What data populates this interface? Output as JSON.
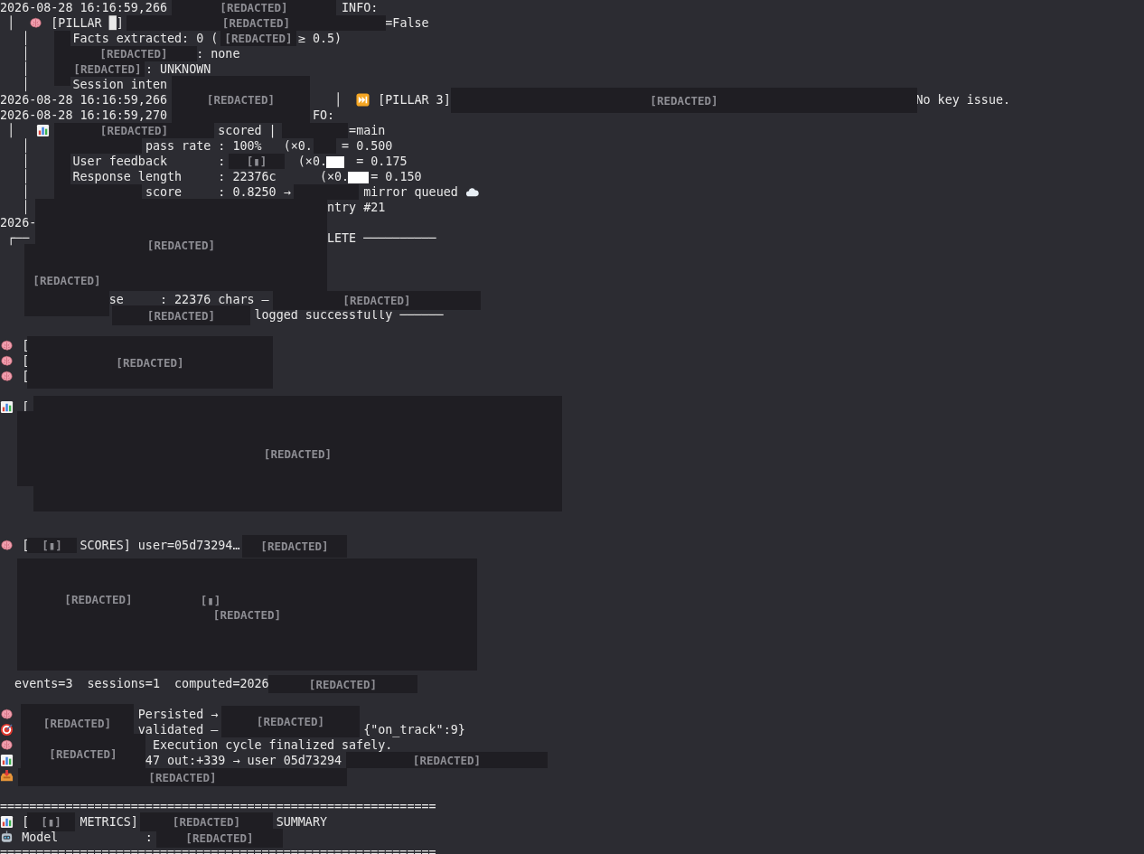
{
  "lines": [
    {
      "parts": [
        {
          "kind": "text",
          "text": "2026-08-28 16:16:59,266"
        },
        {
          "kind": "text",
          "text": "                        INFO:"
        }
      ]
    },
    {
      "parts": [
        {
          "kind": "text",
          "text": " │  "
        },
        {
          "kind": "brain"
        },
        {
          "kind": "text",
          "text": " [PILLAR █]"
        },
        {
          "kind": "text",
          "text": "                                    =False"
        }
      ]
    },
    {
      "parts": [
        {
          "kind": "text",
          "text": "   │"
        },
        {
          "kind": "text",
          "text": "      Facts extracted: 0 ("
        },
        {
          "kind": "text",
          "text": "           ≥ 0.5)"
        }
      ]
    },
    {
      "parts": [
        {
          "kind": "text",
          "text": "   │"
        },
        {
          "kind": "text",
          "text": "                       : none"
        }
      ]
    },
    {
      "parts": [
        {
          "kind": "text",
          "text": "   │"
        },
        {
          "kind": "text",
          "text": "                : UNKNOWN"
        }
      ]
    },
    {
      "parts": [
        {
          "kind": "text",
          "text": "   │"
        },
        {
          "kind": "text",
          "text": "      Session inten"
        }
      ]
    },
    {
      "parts": [
        {
          "kind": "text",
          "text": "2026-08-28 16:16:59,266"
        },
        {
          "kind": "text",
          "text": "                       │  "
        },
        {
          "kind": "skip"
        },
        {
          "kind": "text",
          "text": " [PILLAR 3]"
        },
        {
          "kind": "text",
          "text": "                                                                No key issue."
        }
      ]
    },
    {
      "parts": [
        {
          "kind": "text",
          "text": "2026-08-28 16:16:59,270"
        },
        {
          "kind": "text",
          "text": "                    FO:"
        }
      ]
    },
    {
      "parts": [
        {
          "kind": "text",
          "text": " │   "
        },
        {
          "kind": "chart"
        },
        {
          "kind": "text",
          "text": "                       scored |"
        },
        {
          "kind": "text",
          "text": "          =main"
        }
      ]
    },
    {
      "parts": [
        {
          "kind": "text",
          "text": "   │"
        },
        {
          "kind": "text",
          "text": "                pass rate : 100%   (×0."
        },
        {
          "kind": "text",
          "text": "    = 0.500"
        }
      ]
    },
    {
      "parts": [
        {
          "kind": "text",
          "text": "   │"
        },
        {
          "kind": "text",
          "text": "      User feedback       :"
        },
        {
          "kind": "text",
          "text": "          (×0."
        },
        {
          "kind": "text",
          "text": "    = 0.175"
        }
      ]
    },
    {
      "parts": [
        {
          "kind": "text",
          "text": "   │"
        },
        {
          "kind": "text",
          "text": "      Response length     : 22376c"
        },
        {
          "kind": "text",
          "text": "      (×0."
        },
        {
          "kind": "text",
          "text": "   = 0.150"
        }
      ]
    },
    {
      "parts": [
        {
          "kind": "text",
          "text": "   │"
        },
        {
          "kind": "text",
          "text": "                score     : 0.8250 →"
        },
        {
          "kind": "text",
          "text": "          mirror queued "
        },
        {
          "kind": "cloud"
        }
      ]
    },
    {
      "parts": [
        {
          "kind": "text",
          "text": "   │"
        },
        {
          "kind": "text",
          "text": "                                         ntry #21"
        }
      ]
    },
    {
      "parts": [
        {
          "kind": "text",
          "text": "2026-"
        }
      ]
    },
    {
      "parts": [
        {
          "kind": "text",
          "text": " ┌──"
        },
        {
          "kind": "text",
          "text": "                                         LETE ──────────"
        }
      ]
    },
    {
      "blank": true
    },
    {
      "blank": true
    },
    {
      "blank": true
    },
    {
      "parts": [
        {
          "kind": "text",
          "text": "               se     : 22376 chars —"
        }
      ]
    },
    {
      "parts": [
        {
          "kind": "text",
          "text": "                                   logged successfully ──────"
        }
      ]
    },
    {
      "blank": true
    },
    {
      "parts": [
        {
          "kind": "brain"
        },
        {
          "kind": "text",
          "text": " ["
        }
      ]
    },
    {
      "parts": [
        {
          "kind": "brain"
        },
        {
          "kind": "text",
          "text": " ["
        }
      ]
    },
    {
      "parts": [
        {
          "kind": "brain"
        },
        {
          "kind": "text",
          "text": " ["
        }
      ]
    },
    {
      "blank": true
    },
    {
      "parts": [
        {
          "kind": "chart"
        },
        {
          "kind": "text",
          "text": " ["
        }
      ]
    },
    {
      "blank": true
    },
    {
      "blank": true
    },
    {
      "blank": true
    },
    {
      "blank": true
    },
    {
      "blank": true
    },
    {
      "blank": true
    },
    {
      "blank": true
    },
    {
      "blank": true
    },
    {
      "parts": [
        {
          "kind": "brain"
        },
        {
          "kind": "text",
          "text": " ["
        },
        {
          "kind": "text",
          "text": "       SCORES] user=05d73294…"
        }
      ]
    },
    {
      "blank": true
    },
    {
      "blank": true
    },
    {
      "blank": true
    },
    {
      "blank": true
    },
    {
      "parts": [
        {
          "kind": "cursor"
        }
      ]
    },
    {
      "blank": true
    },
    {
      "blank": true
    },
    {
      "blank": true
    },
    {
      "parts": [
        {
          "kind": "text",
          "text": "  events=3  sessions=1  computed=2026"
        }
      ]
    },
    {
      "blank": true
    },
    {
      "parts": [
        {
          "kind": "brain"
        },
        {
          "kind": "text",
          "text": "                 Persisted →"
        }
      ]
    },
    {
      "parts": [
        {
          "kind": "target"
        },
        {
          "kind": "text",
          "text": "                 validated —"
        },
        {
          "kind": "text",
          "text": "                    {\"on_track\":9}"
        }
      ]
    },
    {
      "parts": [
        {
          "kind": "brain"
        },
        {
          "kind": "text",
          "text": "                   Execution cycle finalized safely."
        }
      ]
    },
    {
      "parts": [
        {
          "kind": "chart"
        },
        {
          "kind": "text",
          "text": "                  47 out:+339 → user 05d73294"
        }
      ]
    },
    {
      "parts": [
        {
          "kind": "inbox"
        }
      ]
    },
    {
      "blank": true
    },
    {
      "parts": [
        {
          "kind": "text",
          "text": "============================================================"
        }
      ]
    },
    {
      "parts": [
        {
          "kind": "chart"
        },
        {
          "kind": "text",
          "text": " ["
        },
        {
          "kind": "text",
          "text": "       METRICS]"
        },
        {
          "kind": "text",
          "text": "                   SUMMARY"
        }
      ]
    },
    {
      "parts": [
        {
          "kind": "robot"
        },
        {
          "kind": "text",
          "text": " Model            :"
        }
      ]
    },
    {
      "parts": [
        {
          "kind": "text",
          "text": "============================================================"
        }
      ]
    }
  ],
  "redactions": [
    {
      "kind": "labeled",
      "label": "[REDACTED]"
    },
    {
      "kind": "labeled",
      "label": "[REDACTED]"
    },
    {
      "kind": "labeled",
      "label": "[REDACTED]"
    },
    {
      "kind": "blank"
    },
    {
      "kind": "labeled",
      "label": "[REDACTED]"
    },
    {
      "kind": "labeled",
      "label": "[REDACTED]"
    },
    {
      "kind": "labeled",
      "label": "[REDACTED]"
    },
    {
      "kind": "labeled",
      "label": "[REDACTED]"
    },
    {
      "kind": "labeled",
      "label": "[REDACTED]"
    },
    {
      "kind": "blank"
    },
    {
      "kind": "blank"
    },
    {
      "kind": "blank"
    },
    {
      "kind": "blank"
    },
    {
      "kind": "blank"
    },
    {
      "kind": "labeled",
      "label": "[▮]"
    },
    {
      "kind": "white"
    },
    {
      "kind": "white"
    },
    {
      "kind": "blank"
    },
    {
      "kind": "labeled",
      "label": "[REDACTED]"
    },
    {
      "kind": "labeled",
      "label": "[REDACTED]"
    },
    {
      "kind": "labeled",
      "label": "[REDACTED]"
    },
    {
      "kind": "labeled",
      "label": "[REDACTED]"
    },
    {
      "kind": "labeled",
      "label": "[REDACTED]"
    },
    {
      "kind": "labeled",
      "label": "[REDACTED]"
    },
    {
      "kind": "blank"
    },
    {
      "kind": "labeled",
      "label": "[▮]"
    },
    {
      "kind": "labeled",
      "label": "[REDACTED]"
    },
    {
      "kind": "labeled",
      "label": "[REDACTED]"
    },
    {
      "kind": "labeled",
      "label": "[REDACTED]"
    },
    {
      "kind": "labeled",
      "label": "[▮]"
    },
    {
      "kind": "labeled",
      "label": "[REDACTED]"
    },
    {
      "kind": "labeled",
      "label": "[REDACTED]"
    },
    {
      "kind": "labeled",
      "label": "[REDACTED]"
    },
    {
      "kind": "labeled",
      "label": "[REDACTED]"
    },
    {
      "kind": "labeled",
      "label": "[REDACTED]"
    },
    {
      "kind": "labeled",
      "label": "[REDACTED]"
    },
    {
      "kind": "labeled",
      "label": "[▮]"
    },
    {
      "kind": "labeled",
      "label": "[REDACTED]"
    },
    {
      "kind": "labeled",
      "label": "[REDACTED]"
    }
  ]
}
